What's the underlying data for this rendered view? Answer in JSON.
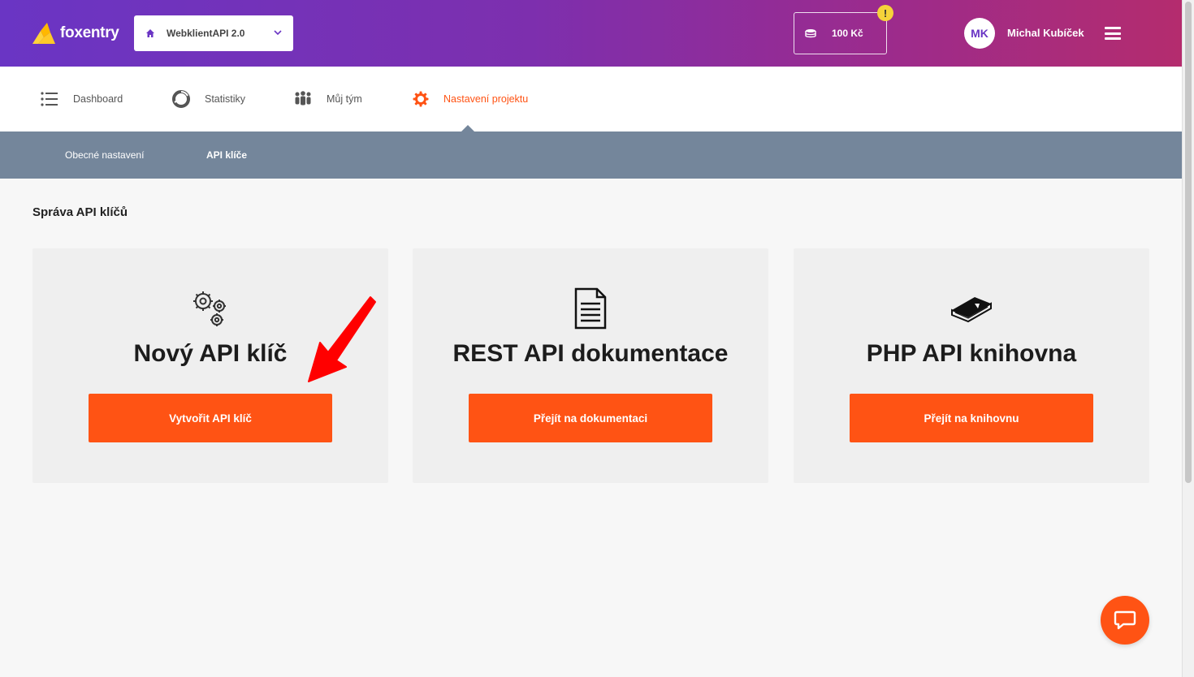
{
  "header": {
    "logo_text": "foxentry",
    "project_name": "WebklientAPI 2.0",
    "credit": "100 Kč",
    "warning_symbol": "!",
    "user_initials": "MK",
    "user_name": "Michal Kubíček"
  },
  "nav": {
    "items": [
      {
        "label": "Dashboard",
        "icon": "list-icon"
      },
      {
        "label": "Statistiky",
        "icon": "pie-chart-icon"
      },
      {
        "label": "Můj tým",
        "icon": "team-icon"
      },
      {
        "label": "Nastavení projektu",
        "icon": "gear-icon",
        "active": true
      }
    ]
  },
  "subnav": {
    "items": [
      {
        "label": "Obecné nastavení"
      },
      {
        "label": "API klíče",
        "active": true
      }
    ]
  },
  "main": {
    "section_title": "Správa API klíčů",
    "cards": [
      {
        "title": "Nový API klíč",
        "button": "Vytvořit API klíč",
        "icon": "gears-icon"
      },
      {
        "title": "REST API dokumentace",
        "button": "Přejít na dokumentaci",
        "icon": "document-icon"
      },
      {
        "title": "PHP API knihovna",
        "button": "Přejít na knihovnu",
        "icon": "book-icon"
      }
    ]
  },
  "colors": {
    "accent": "#ff5314",
    "subnav": "#74869b",
    "header_gradient_start": "#6a35c4",
    "header_gradient_end": "#b42c6e"
  }
}
